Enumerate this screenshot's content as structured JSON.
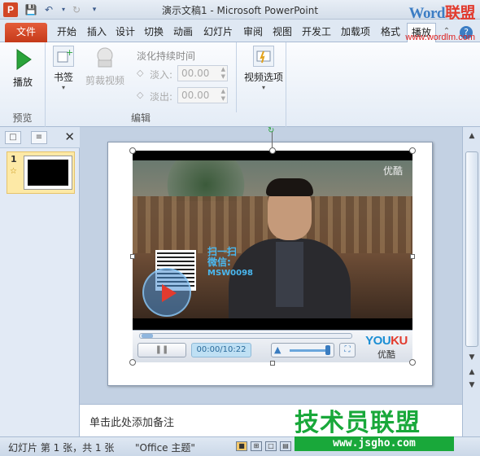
{
  "app": {
    "icon_letter": "P",
    "title": "演示文稿1 - Microsoft PowerPoint",
    "brand_word_1": "Word",
    "brand_word_2": "联盟",
    "brand_url": "www.wordlm.com"
  },
  "quick_access": {
    "save_icon": "floppy-icon",
    "undo_icon": "undo-icon",
    "redo_icon": "redo-icon"
  },
  "tabs": [
    {
      "label": "文件"
    },
    {
      "label": "开始"
    },
    {
      "label": "插入"
    },
    {
      "label": "设计"
    },
    {
      "label": "切换"
    },
    {
      "label": "动画"
    },
    {
      "label": "幻灯片"
    },
    {
      "label": "审阅"
    },
    {
      "label": "视图"
    },
    {
      "label": "开发工"
    },
    {
      "label": "加载项"
    },
    {
      "label": "格式"
    },
    {
      "label": "播放"
    }
  ],
  "ribbon": {
    "preview": {
      "play_label": "播放",
      "group_label": "预览"
    },
    "bookmark": {
      "label": "书签"
    },
    "trim": {
      "label": "剪裁视频"
    },
    "fade": {
      "title": "淡化持续时间",
      "fade_in_label": "淡入:",
      "fade_in_value": "00.00",
      "fade_out_label": "淡出:",
      "fade_out_value": "00.00"
    },
    "edit_group_label": "编辑",
    "video_options": {
      "label": "视频选项"
    }
  },
  "slides_pane": {
    "slide_number": "1",
    "star": "☆"
  },
  "video": {
    "watermark": "优酷",
    "scan_text_1": "扫一扫",
    "scan_text_2": "微信:",
    "scan_text_3": "MSW0098",
    "time": "00:00/10:22",
    "brand_en_1": "YOU",
    "brand_en_2": "KU",
    "brand_zh": "优酷"
  },
  "notes": {
    "placeholder": "单击此处添加备注"
  },
  "overlay": {
    "logo": "技术员联盟",
    "url": "www.jsgho.com"
  },
  "status": {
    "slide_info": "幻灯片 第 1 张，共 1 张",
    "theme": "\"Office 主题\""
  }
}
